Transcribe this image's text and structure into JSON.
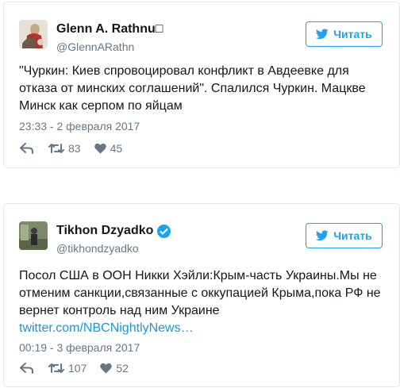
{
  "tweets": [
    {
      "user": {
        "name": "Glenn A. Rathnu□",
        "handle": "@GlennARathn",
        "verified": false
      },
      "follow_label": "Читать",
      "text": "\"Чуркин: Киев спровоцировал конфликт в Авдеевке для отказа от минских соглашений\". Спалился Чуркин. Мацкве Минск как серпом по яйцам",
      "link": "",
      "timestamp": "23:33 - 2 февраля 2017",
      "retweets": "83",
      "likes": "45"
    },
    {
      "user": {
        "name": "Tikhon Dzyadko",
        "handle": "@tikhondzyadko",
        "verified": true
      },
      "follow_label": "Читать",
      "text": "Посол США в ООН Никки Хэйли:Крым-часть Украины.Мы не отменим санкции,связанные с оккупацией Крыма,пока РФ не вернет контроль над ним Украине",
      "link": "twitter.com/NBCNightlyNews…",
      "timestamp": "00:19 - 3 февраля 2017",
      "retweets": "107",
      "likes": "52"
    }
  ],
  "icons": {
    "follow": "twitter-bird-icon",
    "reply": "reply-icon",
    "retweet": "retweet-icon",
    "like": "heart-icon",
    "verified": "verified-badge-icon"
  },
  "colors": {
    "accent": "#1da1f2",
    "link": "#1b95e0",
    "muted": "#657786",
    "border": "#e1e8ed",
    "text": "#14171a"
  }
}
